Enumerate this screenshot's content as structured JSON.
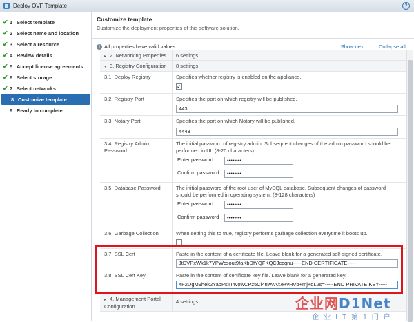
{
  "window": {
    "title": "Deploy OVF Template",
    "help_icon": "help-icon"
  },
  "steps": [
    {
      "num": "1",
      "label": "Select template",
      "done": true
    },
    {
      "num": "2",
      "label": "Select name and location",
      "done": true
    },
    {
      "num": "3",
      "label": "Select a resource",
      "done": true
    },
    {
      "num": "4",
      "label": "Review details",
      "done": true
    },
    {
      "num": "5",
      "label": "Accept license agreements",
      "done": true
    },
    {
      "num": "6",
      "label": "Select storage",
      "done": true
    },
    {
      "num": "7",
      "label": "Select networks",
      "done": true
    },
    {
      "num": "8",
      "label": "Customize template",
      "active": true
    },
    {
      "num": "9",
      "label": "Ready to complete"
    }
  ],
  "header": {
    "title": "Customize template",
    "subtitle": "Customize the deployment properties of this software solution."
  },
  "status": {
    "valid_text": "All properties have valid values",
    "show_next": "Show next...",
    "collapse_all": "Collapse all..."
  },
  "groups": {
    "networking": {
      "label": "2. Networking Properties",
      "value": "6 settings"
    },
    "registry": {
      "label": "3. Registry Configuration",
      "value": "8 settings"
    },
    "management": {
      "label": "4. Management Portal Configuration",
      "value": "4 settings"
    }
  },
  "props": {
    "deploy_registry": {
      "label": "3.1. Deploy Registry",
      "desc": "Specifies whether registry is enabled on the appliance.",
      "checked": true
    },
    "registry_port": {
      "label": "3.2. Registry Port",
      "desc": "Specifies the port on which registry will be published.",
      "value": "443"
    },
    "notary_port": {
      "label": "3.3. Notary Port",
      "desc": "Specifies the port on which Notary will be published.",
      "value": "4443"
    },
    "admin_password": {
      "label": "3.4. Registry Admin Password",
      "desc": "The initial password of registry admin. Subsequent changes of the admin password should be performed in UI. (8-20 characters)",
      "enter_label": "Enter password",
      "confirm_label": "Confirm password",
      "enter_value": "••••••••",
      "confirm_value": "••••••••"
    },
    "db_password": {
      "label": "3.5. Database Password",
      "desc": "The initial password of the root user of MySQL database. Subsequent changes of password should be performed in operating system. (8-128 characters)",
      "enter_label": "Enter password",
      "confirm_label": "Confirm password",
      "enter_value": "••••••••",
      "confirm_value": "••••••••"
    },
    "garbage": {
      "label": "3.6. Garbage Collection",
      "desc": "When setting this to true, registry performs garbage collection everytime it boots up.",
      "checked": false
    },
    "ssl_cert": {
      "label": "3.7. SSL Cert",
      "desc": "Paste in the content of a certificate file. Leave blank for a generated self-signed certificate.",
      "value": "JtDVPxWk1k7YPWcsout9faKbDfYQFKQCJccqnu-----END CERTIFICATE-----"
    },
    "ssl_key": {
      "label": "3.8. SSL Cert Key",
      "desc": "Paste in the content of certificate key file. Leave blank for a generated key.",
      "value": "4F2UgM9hek2YabPsTI4vowCPz5Cl4nwvAXe+vRVb+mj+qL2s=-----END PRIVATE KEY-----"
    }
  },
  "watermark": {
    "big_prefix": "企业网",
    "big_suffix": "D1Net",
    "small": "企业IT第1门户"
  }
}
